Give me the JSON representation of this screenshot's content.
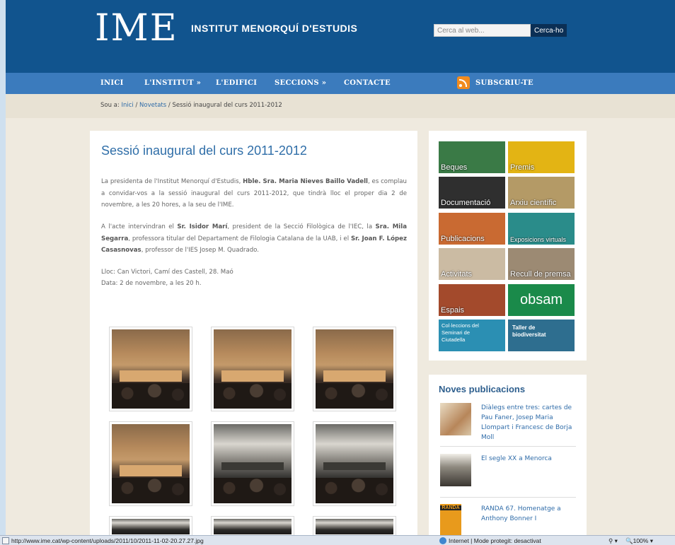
{
  "header": {
    "logo": "IME",
    "subtitle": "INSTITUT MENORQUÍ D'ESTUDIS",
    "search_placeholder": "Cerca al web...",
    "search_button": "Cerca-ho"
  },
  "nav": {
    "items": [
      "INICI",
      "L'INSTITUT »",
      "L'EDIFICI",
      "SECCIONS »",
      "CONTACTE"
    ],
    "subscribe": "SUBSCRIU-TE"
  },
  "breadcrumb": {
    "prefix": "Sou a:",
    "home": "Inici",
    "section": "Novetats",
    "current": "Sessió inaugural del curs 2011-2012"
  },
  "article": {
    "title": "Sessió inaugural del curs 2011-2012",
    "p1_a": "La presidenta de l'Institut Menorquí d'Estudis, ",
    "p1_b": "Hble. Sra. Maria Nieves Baillo Vadell",
    "p1_c": ", es complau a convidar-vos a la sessió inaugural del curs 2011-2012, que tindrà lloc el proper dia 2 de novembre, a les 20 hores, a la seu de l'IME.",
    "p2_a": "A l'acte intervindran el ",
    "p2_b": "Sr. Isidor Marí",
    "p2_c": ", president de la Secció Filològica de l'IEC, la ",
    "p2_d": "Sra. Mila Segarra",
    "p2_e": ", professora titular del Departament de Filologia Catalana de la UAB, i el ",
    "p2_f": "Sr. Joan F. López Casasnovas",
    "p2_g": ", professor de l'IES Josep M. Quadrado.",
    "place": "Lloc: Can Victori, Camí des Castell, 28. Maó",
    "date": "Data: 2 de novembre, a les 20 h."
  },
  "tiles": [
    {
      "label": "Beques",
      "color": "#3a7a46"
    },
    {
      "label": "Premis",
      "color": "#e3b414"
    },
    {
      "label": "Documentació",
      "color": "#2f2f2f"
    },
    {
      "label": "Arxiu científic",
      "color": "#b49a66"
    },
    {
      "label": "Publicacions",
      "color": "#c96a32"
    },
    {
      "label": "Exposicions virtuals",
      "color": "#2a8c8a"
    },
    {
      "label": "Activitats",
      "color": "#cbbba3"
    },
    {
      "label": "Recull de premsa",
      "color": "#9c8a73"
    },
    {
      "label": "Espais",
      "color": "#a34a2c"
    },
    {
      "label": "obsam",
      "color": "#1a8a4a"
    },
    {
      "label": "Col·leccions del Seminari de Ciutadella",
      "color": "#2b8fb3"
    },
    {
      "label": "Taller de biodiversitat",
      "color": "#2e6e8f"
    }
  ],
  "publications": {
    "heading": "Noves publicacions",
    "items": [
      "Diàlegs entre tres: cartes de Pau Faner, Josep Maria Llompart i Francesc de Borja Moll",
      "El segle XX a Menorca",
      "RANDA 67. Homenatge a Anthony Bonner I"
    ],
    "randa_cover": "RANDA"
  },
  "statusbar": {
    "url": "http://www.ime.cat/wp-content/uploads/2011/10/2011-11-02-20.27.27.jpg",
    "zone": "Internet | Mode protegit: desactivat",
    "zoom": "100%"
  }
}
